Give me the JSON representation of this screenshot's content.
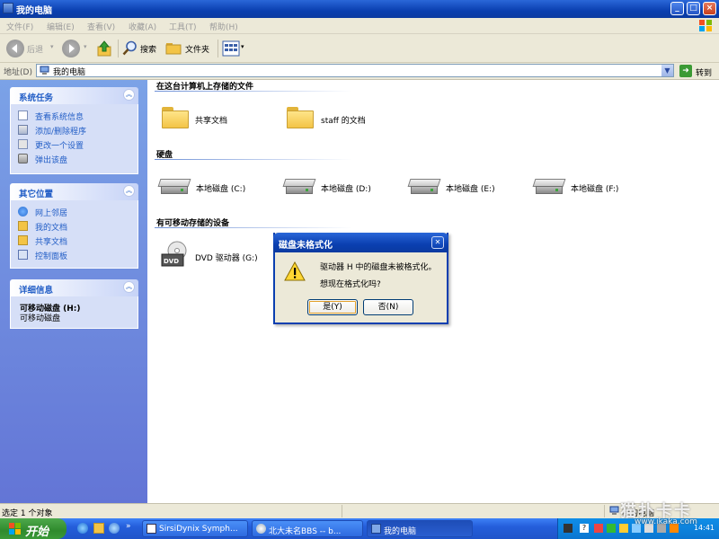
{
  "window": {
    "title": "我的电脑",
    "controls": {
      "minimize": "_",
      "maximize": "□",
      "close": "×"
    }
  },
  "menu": {
    "items": [
      "文件(F)",
      "编辑(E)",
      "查看(V)",
      "收藏(A)",
      "工具(T)",
      "帮助(H)"
    ]
  },
  "toolbar": {
    "back_label": "后退",
    "search_label": "搜索",
    "folders_label": "文件夹"
  },
  "address": {
    "label": "地址(D)",
    "value": "我的电脑",
    "go_label": "转到"
  },
  "left_panels": {
    "system_tasks": {
      "title": "系统任务",
      "links": [
        "查看系统信息",
        "添加/删除程序",
        "更改一个设置",
        "弹出该盘"
      ]
    },
    "other_places": {
      "title": "其它位置",
      "links": [
        "网上邻居",
        "我的文档",
        "共享文档",
        "控制面板"
      ]
    },
    "details": {
      "title": "详细信息",
      "name": "可移动磁盘 (H:)",
      "type": "可移动磁盘"
    }
  },
  "sections": {
    "stored_files": {
      "title": "在这台计算机上存储的文件",
      "items": [
        "共享文档",
        "staff 的文档"
      ]
    },
    "hard_disks": {
      "title": "硬盘",
      "items": [
        "本地磁盘 (C:)",
        "本地磁盘 (D:)",
        "本地磁盘 (E:)",
        "本地磁盘 (F:)"
      ]
    },
    "removable": {
      "title": "有可移动存储的设备",
      "items": [
        "DVD 驱动器 (G:)"
      ]
    }
  },
  "dialog": {
    "title": "磁盘未格式化",
    "message_line1": "驱动器 H 中的磁盘未被格式化。",
    "message_line2": "想现在格式化吗?",
    "yes_label": "是(Y)",
    "no_label": "否(N)"
  },
  "status": {
    "left": "选定 1 个对象",
    "right": "我的电脑"
  },
  "taskbar": {
    "start_label": "开始",
    "tasks": [
      "SirsiDynix Symph...",
      "北大未名BBS -- b...",
      "我的电脑"
    ],
    "clock": "14:41"
  },
  "watermark": {
    "logo": "猫扑卡卡",
    "url": "www.ikaka.com"
  },
  "icons": {
    "title": "computer-icon",
    "back": "back-arrow-icon",
    "forward": "forward-arrow-icon",
    "up": "up-folder-icon",
    "search": "magnifier-icon",
    "folders": "folder-icon",
    "views": "view-grid-icon",
    "warning": "warning-icon"
  },
  "colors": {
    "xp_blue": "#0a3fb0",
    "task_pane": "#7ba2e7",
    "link_blue": "#215dc6",
    "window_face": "#ece9d8"
  }
}
